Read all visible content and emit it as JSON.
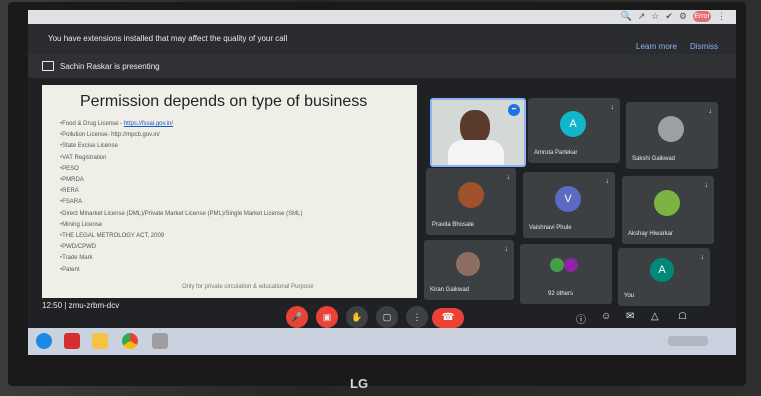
{
  "notice": {
    "message": "You have extensions installed that may affect the quality of your call",
    "learn_more": "Learn more",
    "dismiss": "Dismiss"
  },
  "presenter": {
    "text": "Sachin Raskar is presenting"
  },
  "slide": {
    "title": "Permission depends on type of business",
    "items": [
      {
        "text": "Food & Drug License - ",
        "link": "https://fssai.gov.in/"
      },
      {
        "text": "Pollution License- http://mpcb.gov.in/",
        "link": ""
      },
      {
        "text": "State Excise License",
        "link": ""
      },
      {
        "text": "VAT Registration",
        "link": ""
      },
      {
        "text": "PESO",
        "link": ""
      },
      {
        "text": "PMRDA",
        "link": ""
      },
      {
        "text": "RERA",
        "link": ""
      },
      {
        "text": "FSARA",
        "link": ""
      },
      {
        "text": "Direct Minarket License (DML)/Private Market License (PML)/Single Market License (SML)",
        "link": ""
      },
      {
        "text": "Mining License",
        "link": ""
      },
      {
        "text": "THE LEGAL METROLOGY ACT, 2009",
        "link": ""
      },
      {
        "text": "PWD/CPWD",
        "link": ""
      },
      {
        "text": "Trade Mark",
        "link": ""
      },
      {
        "text": "Patent",
        "link": ""
      }
    ],
    "footer": "Only for private circulation & educational Purpose"
  },
  "participants": [
    {
      "name": "",
      "kind": "video"
    },
    {
      "name": "Amruta Parlekar",
      "initial": "A",
      "color": "#12b5cb"
    },
    {
      "name": "Sakshi Gaikwad",
      "initial": "",
      "color": "#9aa0a6"
    },
    {
      "name": "Pravita Bhosale",
      "initial": "",
      "color": "#a0522d"
    },
    {
      "name": "Vaishnavi Phule",
      "initial": "V",
      "color": "#5c6bc0"
    },
    {
      "name": "Akshay Hiwarkar",
      "initial": "",
      "color": "#7cb342"
    },
    {
      "name": "Kiran Gaikwad",
      "initial": "",
      "color": "#8d6e63"
    },
    {
      "name": "92 others",
      "initial": "",
      "color": "#43a047"
    },
    {
      "name": "You",
      "initial": "A",
      "color": "#00897b"
    }
  ],
  "meeting": {
    "time": "12:50",
    "code": "zmu-zrbm-dcv"
  },
  "chrome": {
    "profile": "Error"
  },
  "monitor_brand": "LG"
}
